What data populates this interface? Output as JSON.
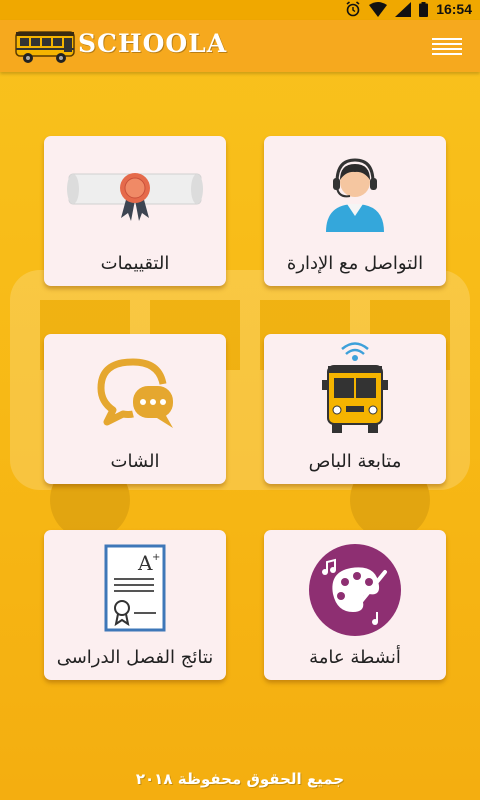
{
  "status_bar": {
    "time": "16:54"
  },
  "app": {
    "brand": "SCHOOLA"
  },
  "menu": {
    "icon": "hamburger-menu-icon"
  },
  "cards": [
    {
      "label": "التقييمات",
      "icon": "certificate-icon"
    },
    {
      "label": "التواصل مع الإدارة",
      "icon": "support-agent-icon"
    },
    {
      "label": "الشات",
      "icon": "chat-bubbles-icon"
    },
    {
      "label": "متابعة الباص",
      "icon": "bus-tracking-icon"
    },
    {
      "label": "نتائج الفصل الدراسى",
      "icon": "exam-result-icon"
    },
    {
      "label": "أنشطة عامة",
      "icon": "palette-activities-icon"
    }
  ],
  "footer": {
    "text": "جميع الحقوق محفوظة ٢٠١٨"
  },
  "colors": {
    "background": "#F9C21D",
    "appbar": "#F6A91E",
    "card": "#FCEFF0",
    "accent_purple": "#8E2F72"
  }
}
